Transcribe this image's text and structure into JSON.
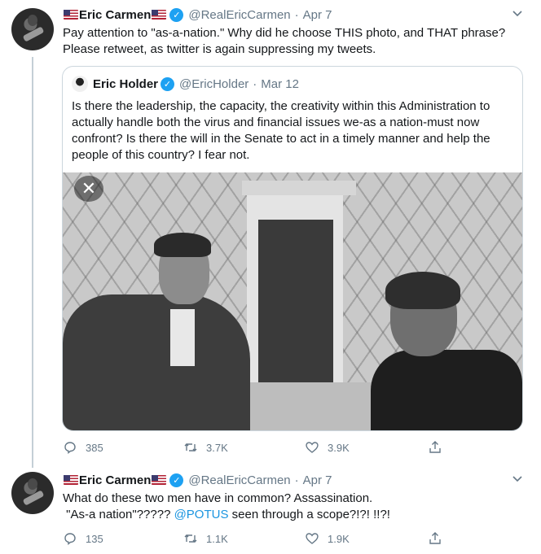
{
  "tweet1": {
    "display_name": "Eric Carmen",
    "handle": "@RealEricCarmen",
    "separator": "·",
    "date": "Apr 7",
    "text": "Pay attention to \"as-a-nation.\" Why did he choose THIS photo, and THAT phrase? Please retweet, as twitter is again suppressing my tweets.",
    "quoted": {
      "display_name": "Eric Holder",
      "handle": "@EricHolder",
      "separator": "·",
      "date": "Mar 12",
      "text": "Is there the leadership, the capacity, the creativity within this Administration to actually handle both the virus and financial issues we-as a nation-must now confront? Is there the will in the Senate to act in a timely manner and help the people of this country?  I fear not.",
      "close_symbol": "✕"
    },
    "stats": {
      "replies": "385",
      "retweets": "3.7K",
      "likes": "3.9K"
    }
  },
  "tweet2": {
    "display_name": "Eric Carmen",
    "handle": "@RealEricCarmen",
    "separator": "·",
    "date": "Apr 7",
    "line1": "What do these two men have in common? Assassination.",
    "line2_pre": " \"As-a nation\"????? ",
    "mention": "@POTUS",
    "line2_post": " seen through a scope?!?! !!?!",
    "stats": {
      "replies": "135",
      "retweets": "1.1K",
      "likes": "1.9K"
    }
  },
  "icons": {
    "verified": "verified-badge-icon",
    "flag": "us-flag-emoji",
    "more": "chevron-down-icon",
    "reply": "reply-icon",
    "retweet": "retweet-icon",
    "like": "heart-icon",
    "share": "share-icon"
  },
  "colors": {
    "accent": "#1da1f2",
    "link": "#1b95e0",
    "secondary_text": "#657786",
    "border": "#ccd6dd"
  }
}
